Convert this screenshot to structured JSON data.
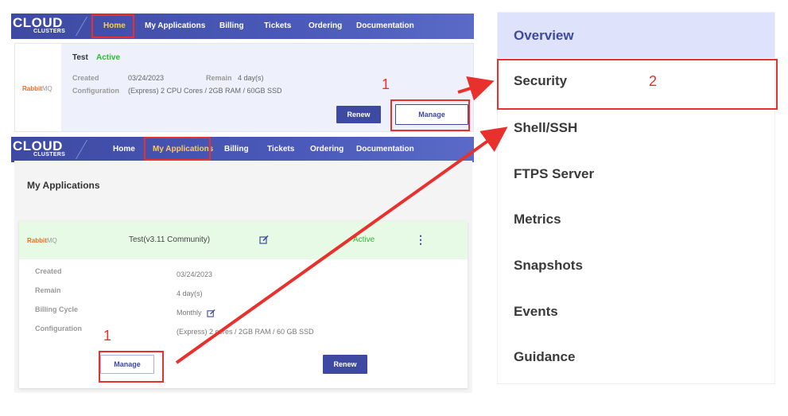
{
  "nav": {
    "brand": "CLOUD",
    "brand_sub": "CLUSTERS",
    "items": [
      "Home",
      "My Applications",
      "Billing",
      "Tickets",
      "Ordering",
      "Documentation"
    ]
  },
  "home_card": {
    "app_name": "Test",
    "status": "Active",
    "logo_text": "Rabbit",
    "logo_suffix": "MQ",
    "created_label": "Created",
    "created_value": "03/24/2023",
    "remain_label": "Remain",
    "remain_value": "4 day(s)",
    "config_label": "Configuration",
    "config_value": "(Express) 2 CPU Cores / 2GB RAM / 60GB SSD",
    "renew_label": "Renew",
    "manage_label": "Manage"
  },
  "apps_page": {
    "title": "My Applications",
    "logo_text": "Rabbit",
    "logo_suffix": "MQ",
    "app_title": "Test(v3.11 Community)",
    "status": "Active",
    "more_glyph": "⋮",
    "details": [
      {
        "label": "Created",
        "value": "03/24/2023"
      },
      {
        "label": "Remain",
        "value": "4 day(s)"
      },
      {
        "label": "Billing Cycle",
        "value": "Monthly"
      },
      {
        "label": "Configuration",
        "value": "(Express) 2 cores / 2GB RAM / 60 GB SSD"
      }
    ],
    "manage_label": "Manage",
    "renew_label": "Renew"
  },
  "side_menu": {
    "items": [
      "Overview",
      "Security",
      "Shell/SSH",
      "FTPS Server",
      "Metrics",
      "Snapshots",
      "Events",
      "Guidance"
    ],
    "active": "Overview"
  },
  "annotations": {
    "step1_top": "1",
    "step1_bottom": "1",
    "step2": "2"
  },
  "colors": {
    "nav_bg": "#4a59b9",
    "primary": "#3e4aa2",
    "highlight": "#e8312c",
    "active_green": "#2ebd2e",
    "rabbit_orange": "#f26b21"
  },
  "icons": [
    "edit-icon",
    "more-vertical-icon",
    "arrow-icon"
  ]
}
